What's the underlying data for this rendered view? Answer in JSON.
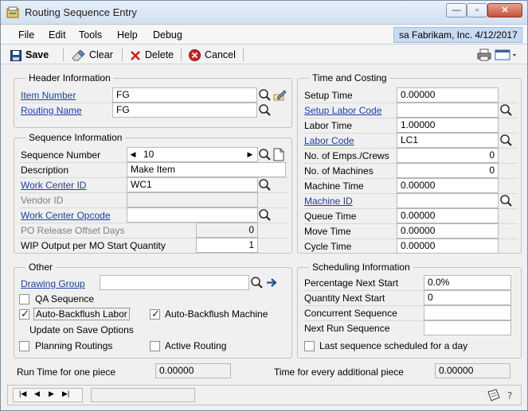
{
  "window": {
    "title": "Routing Sequence Entry"
  },
  "menu": {
    "items": [
      "File",
      "Edit",
      "Tools",
      "Help",
      "Debug"
    ],
    "user_info": "sa  Fabrikam, Inc.  4/12/2017"
  },
  "toolbar": {
    "save_label": "Save",
    "clear_label": "Clear",
    "delete_label": "Delete",
    "cancel_label": "Cancel"
  },
  "header_info": {
    "title": "Header Information",
    "item_number_label": "Item Number",
    "item_number_value": "FG",
    "routing_name_label": "Routing Name",
    "routing_name_value": "FG"
  },
  "sequence_info": {
    "title": "Sequence Information",
    "sequence_number_label": "Sequence Number",
    "sequence_number_value": "10",
    "description_label": "Description",
    "description_value": "Make Item",
    "work_center_id_label": "Work Center ID",
    "work_center_id_value": "WC1",
    "vendor_id_label": "Vendor ID",
    "vendor_id_value": "",
    "work_center_opcode_label": "Work Center Opcode",
    "work_center_opcode_value": "",
    "po_release_label": "PO Release Offset Days",
    "po_release_value": "0",
    "wip_output_label": "WIP Output per MO Start Quantity",
    "wip_output_value": "1"
  },
  "time_costing": {
    "title": "Time and Costing",
    "setup_time_label": "Setup Time",
    "setup_time_value": "0.00000",
    "setup_labor_code_label": "Setup Labor Code",
    "setup_labor_code_value": "",
    "labor_time_label": "Labor Time",
    "labor_time_value": "1.00000",
    "labor_code_label": "Labor Code",
    "labor_code_value": "LC1",
    "emps_crews_label": "No. of Emps./Crews",
    "emps_crews_value": "0",
    "machines_label": "No. of Machines",
    "machines_value": "0",
    "machine_time_label": "Machine Time",
    "machine_time_value": "0.00000",
    "machine_id_label": "Machine ID",
    "machine_id_value": "",
    "queue_time_label": "Queue Time",
    "queue_time_value": "0.00000",
    "move_time_label": "Move Time",
    "move_time_value": "0.00000",
    "cycle_time_label": "Cycle Time",
    "cycle_time_value": "0.00000"
  },
  "other": {
    "title": "Other",
    "drawing_group_label": "Drawing Group",
    "drawing_group_value": "",
    "qa_sequence_label": "QA Sequence",
    "qa_sequence_checked": false,
    "auto_backflush_labor_label": "Auto-Backflush Labor",
    "auto_backflush_labor_checked": true,
    "auto_backflush_machine_label": "Auto-Backflush Machine",
    "auto_backflush_machine_checked": true,
    "update_on_save_label": "Update on Save Options",
    "planning_routings_label": "Planning Routings",
    "planning_routings_checked": false,
    "active_routing_label": "Active Routing",
    "active_routing_checked": false
  },
  "scheduling": {
    "title": "Scheduling Information",
    "pct_next_start_label": "Percentage Next Start",
    "pct_next_start_value": "0.0%",
    "qty_next_start_label": "Quantity Next Start",
    "qty_next_start_value": "0",
    "concurrent_seq_label": "Concurrent Sequence",
    "concurrent_seq_value": "",
    "next_run_seq_label": "Next Run Sequence",
    "next_run_seq_value": "",
    "last_seq_label": "Last sequence scheduled for a day",
    "last_seq_checked": false
  },
  "footer": {
    "run_time_label": "Run Time for one piece",
    "run_time_value": "0.00000",
    "time_additional_label": "Time for every additional piece",
    "time_additional_value": "0.00000"
  }
}
